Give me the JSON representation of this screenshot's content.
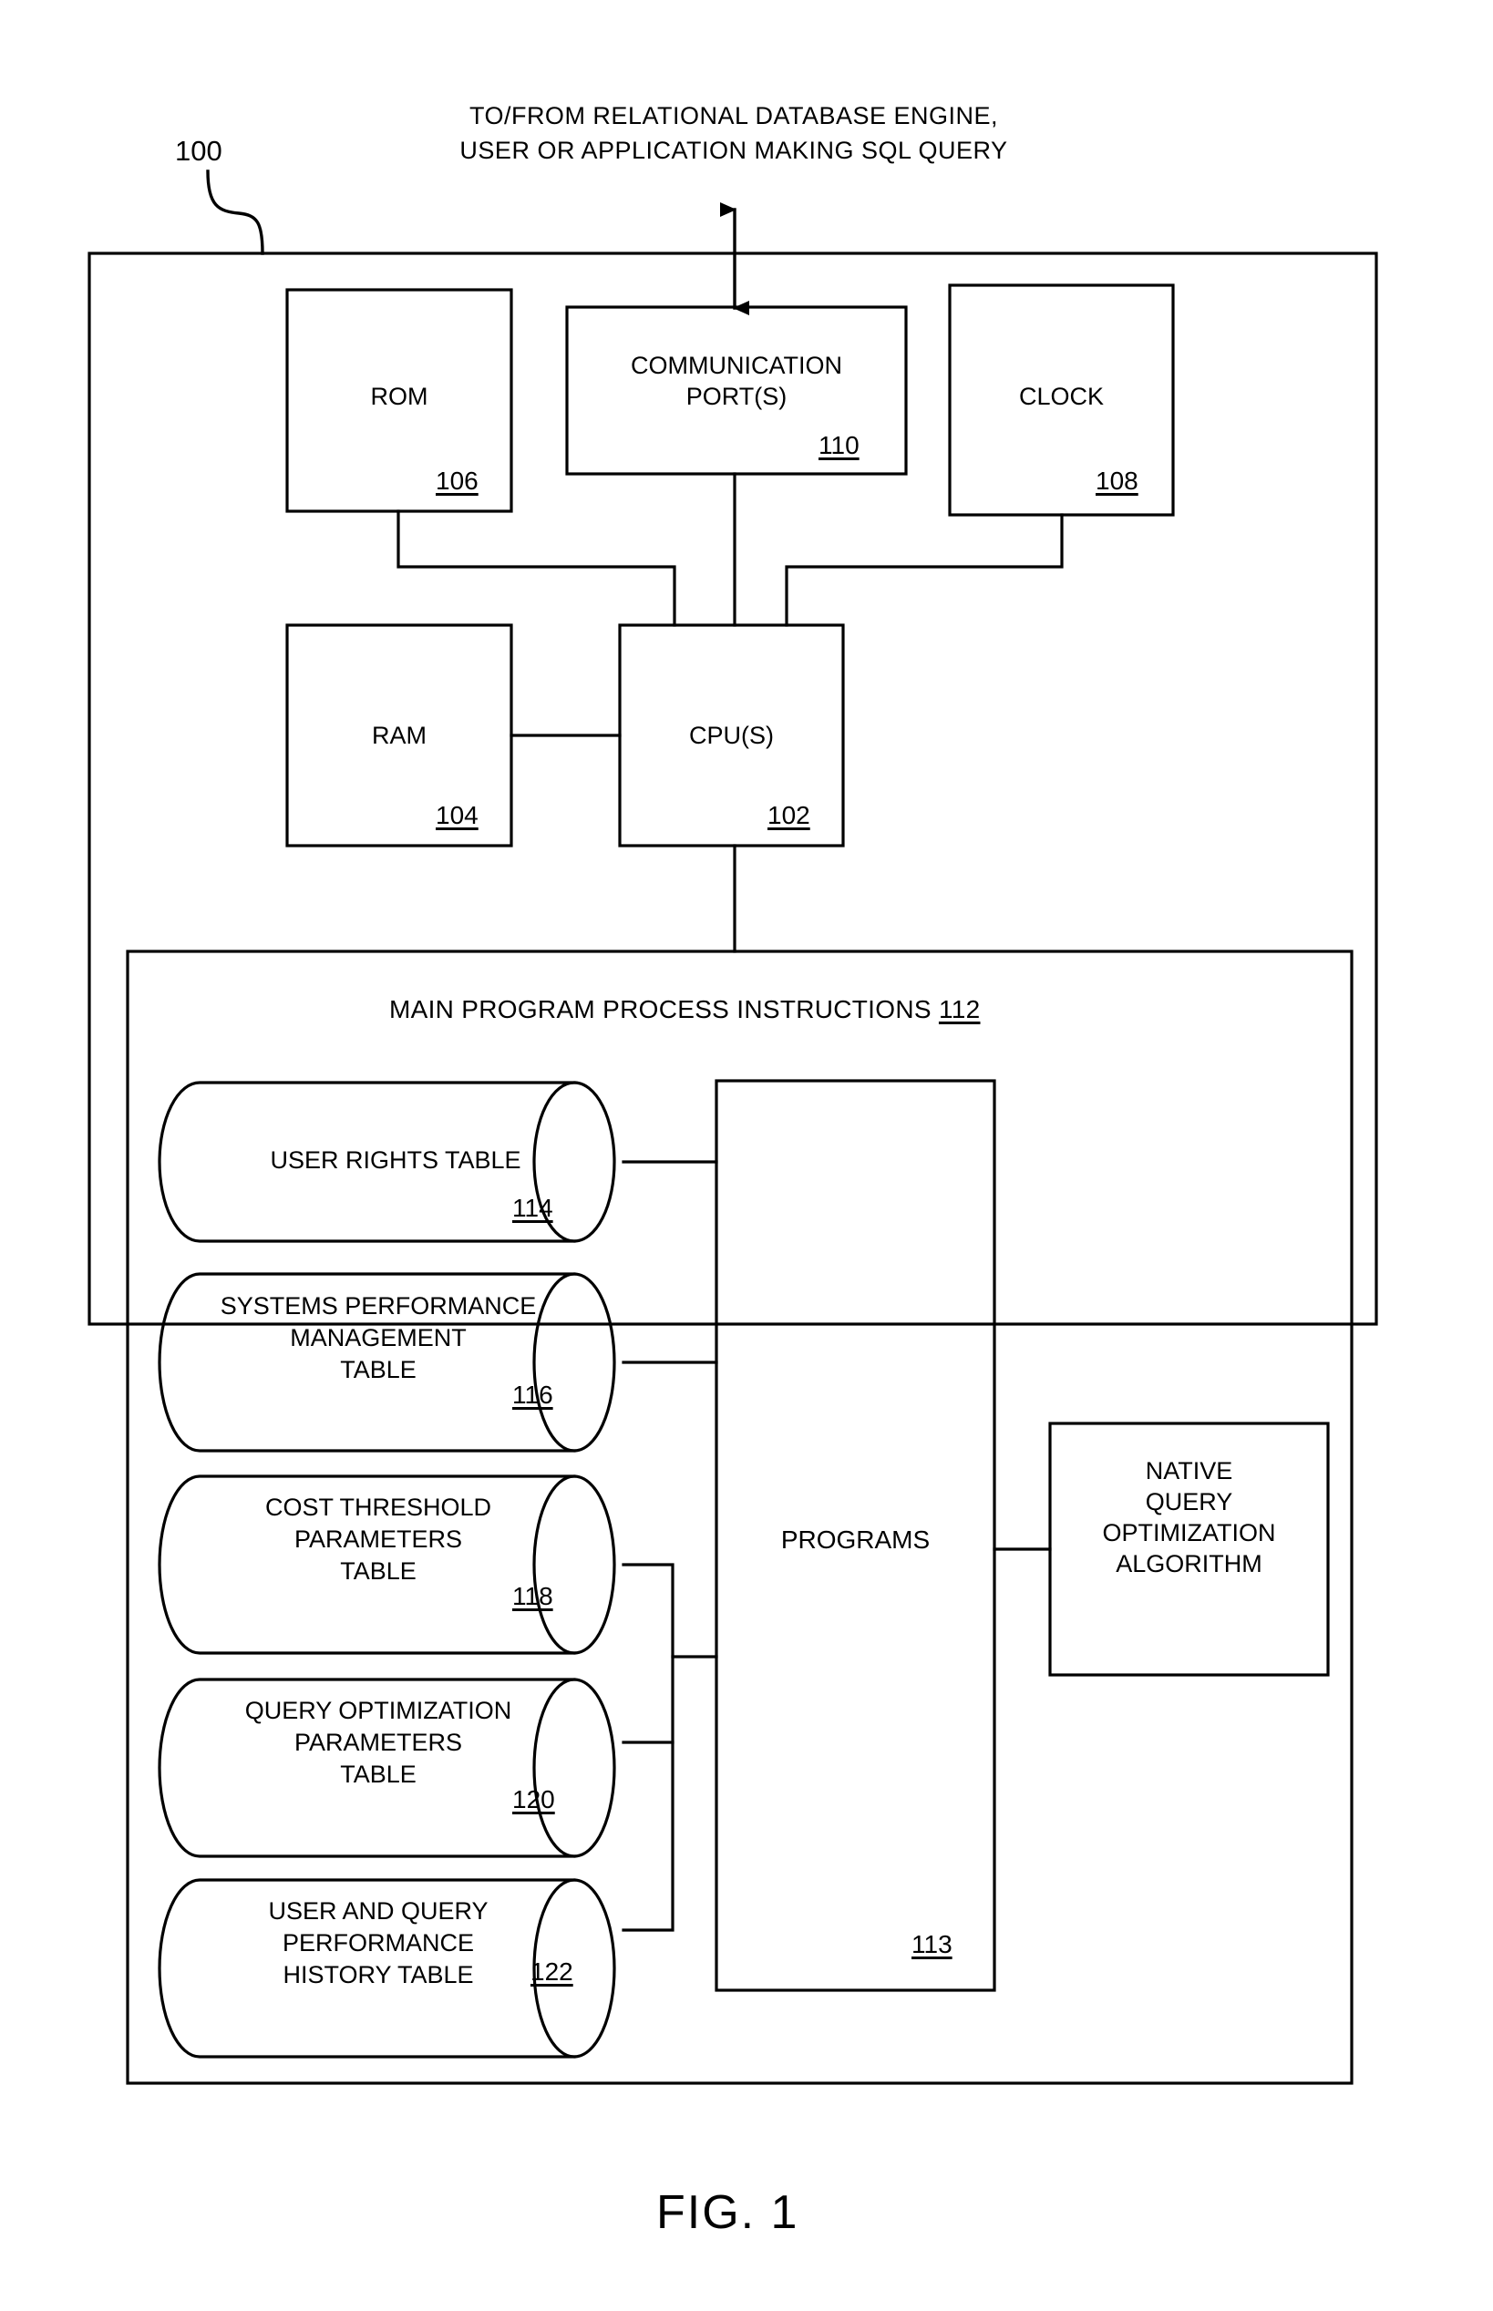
{
  "figure": {
    "label": "FIG. 1",
    "system_ref": "100",
    "top_caption_line1": "TO/FROM RELATIONAL DATABASE ENGINE,",
    "top_caption_line2": "USER OR APPLICATION MAKING SQL QUERY"
  },
  "hardware_boxes": [
    {
      "label": "ROM",
      "ref": "106"
    },
    {
      "label": "COMMUNICATION\nPORT(S)",
      "ref": "110"
    },
    {
      "label": "CLOCK",
      "ref": "108"
    },
    {
      "label": "RAM",
      "ref": "104"
    },
    {
      "label": "CPU(S)",
      "ref": "102"
    }
  ],
  "main_program": {
    "title": "MAIN PROGRAM PROCESS INSTRUCTIONS",
    "ref": "112"
  },
  "tables": [
    {
      "label": "USER RIGHTS TABLE",
      "ref": "114"
    },
    {
      "label": "SYSTEMS  PERFORMANCE\nMANAGEMENT\nTABLE",
      "ref": "116"
    },
    {
      "label": "COST THRESHOLD\nPARAMETERS\nTABLE",
      "ref": "118"
    },
    {
      "label": "QUERY  OPTIMIZATION\nPARAMETERS\nTABLE",
      "ref": "120"
    },
    {
      "label": "USER AND QUERY\nPERFORMANCE\nHISTORY TABLE",
      "ref": "122"
    }
  ],
  "programs_box": {
    "label": "PROGRAMS",
    "ref": "113"
  },
  "native_algorithm_box": {
    "label": "NATIVE\nQUERY\nOPTIMIZATION\nALGORITHM"
  },
  "colors": {
    "ink": "#000000",
    "paper": "#ffffff"
  }
}
